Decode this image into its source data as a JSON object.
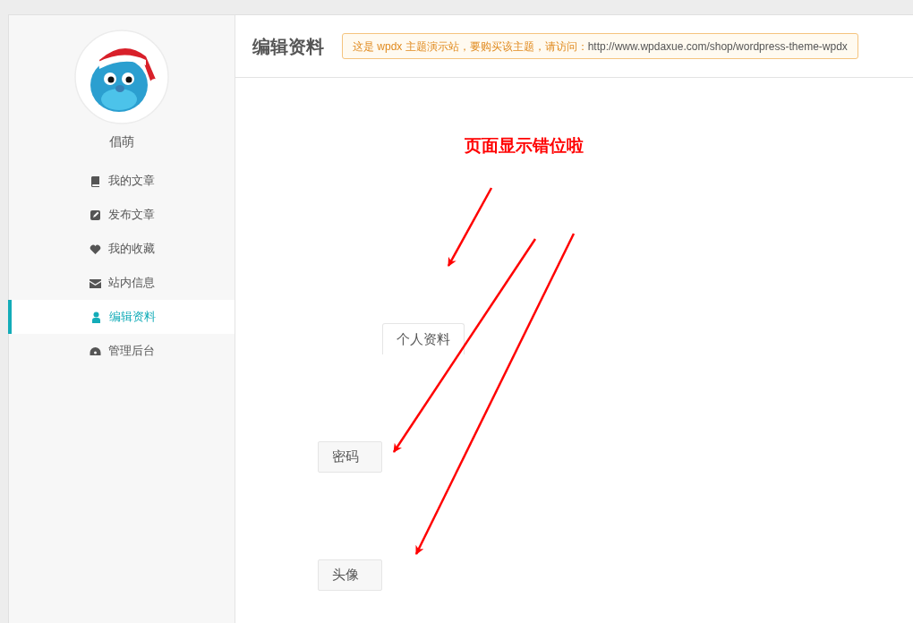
{
  "sidebar": {
    "user_name": "倡萌",
    "items": [
      {
        "label": "我的文章",
        "selected": false
      },
      {
        "label": "发布文章",
        "selected": false
      },
      {
        "label": "我的收藏",
        "selected": false
      },
      {
        "label": "站内信息",
        "selected": false
      },
      {
        "label": "编辑资料",
        "selected": true
      },
      {
        "label": "管理后台",
        "selected": false
      }
    ]
  },
  "header": {
    "title": "编辑资料",
    "notice": {
      "text": "这是 wpdx 主题演示站，要购买该主题，请访问：",
      "link": "http://www.wpdaxue.com/shop/wordpress-theme-wpdx"
    }
  },
  "tabs": [
    {
      "label": "个人资料",
      "selected": true
    },
    {
      "label": "密码",
      "selected": false
    },
    {
      "label": "头像",
      "selected": false
    }
  ],
  "annotation": {
    "text": "页面显示错位啦"
  }
}
